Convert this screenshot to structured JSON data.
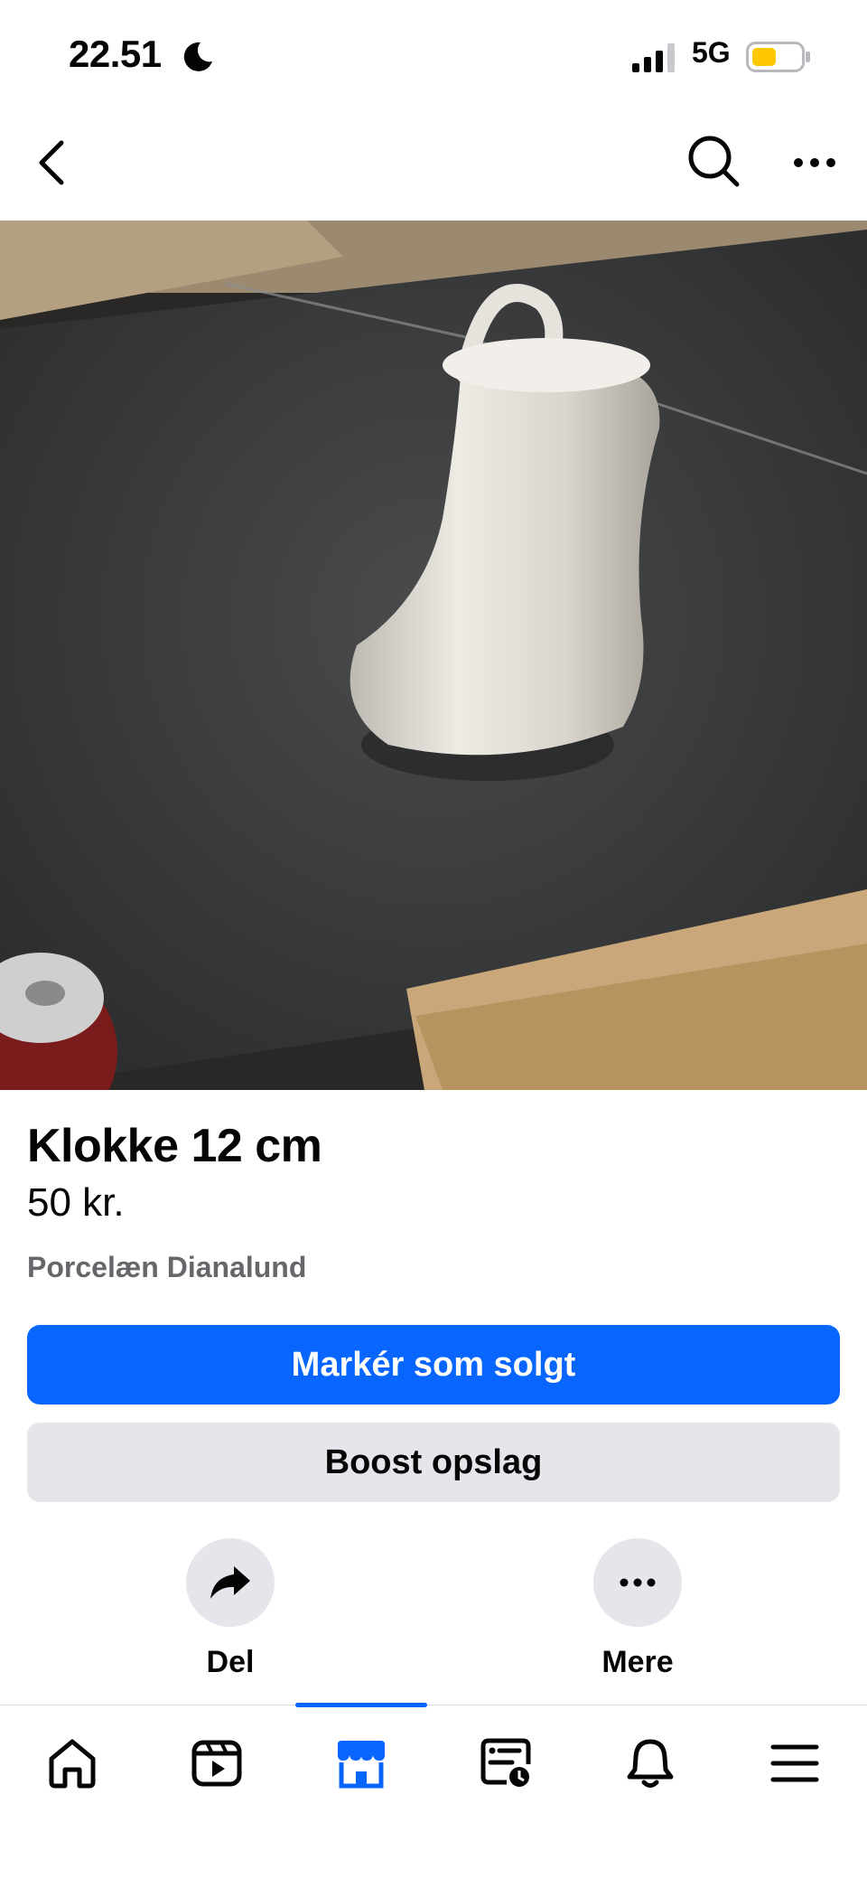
{
  "status_bar": {
    "time": "22.51",
    "network": "5G",
    "battery_color": "#ffc800"
  },
  "header": {
    "back_icon": "chevron-left-icon",
    "search_icon": "search-icon",
    "more_icon": "more-horizontal-icon"
  },
  "listing": {
    "title": "Klokke 12 cm",
    "price": "50 kr.",
    "location": "Porcelæn Dianalund",
    "primary_action": "Markér som solgt",
    "secondary_action": "Boost opslag"
  },
  "actions": [
    {
      "label": "Del",
      "icon": "share-arrow-icon"
    },
    {
      "label": "Mere",
      "icon": "more-horizontal-icon"
    }
  ],
  "tabs": [
    {
      "icon": "home-icon"
    },
    {
      "icon": "video-icon"
    },
    {
      "icon": "marketplace-icon",
      "active": true
    },
    {
      "icon": "feeds-icon"
    },
    {
      "icon": "bell-icon"
    },
    {
      "icon": "menu-icon"
    }
  ],
  "colors": {
    "accent": "#0866ff",
    "secondary_button": "#e4e6eb",
    "muted_text": "#65676b"
  }
}
